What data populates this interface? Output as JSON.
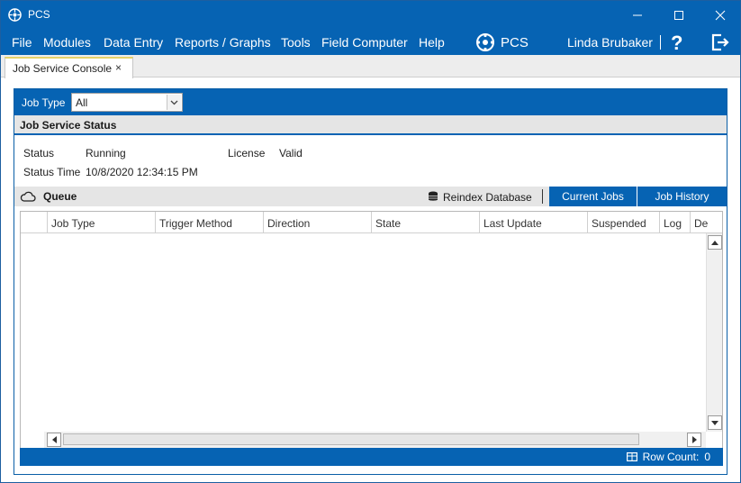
{
  "window": {
    "title": "PCS",
    "controls": {
      "minimize_icon": "minimize-icon",
      "maximize_icon": "maximize-icon",
      "close_icon": "close-icon"
    }
  },
  "menu": {
    "items": [
      "File",
      "Modules",
      "Data Entry",
      "Reports / Graphs",
      "Tools",
      "Field Computer",
      "Help"
    ],
    "brand": "PCS",
    "user": "Linda Brubaker",
    "help_label": "?"
  },
  "tabs": [
    {
      "label": "Job Service Console",
      "close": "×"
    }
  ],
  "filter": {
    "label": "Job Type",
    "value": "All"
  },
  "status": {
    "title": "Job Service Status",
    "status_label": "Status",
    "status_value": "Running",
    "license_label": "License",
    "license_value": "Valid",
    "time_label": "Status Time",
    "time_value": "10/8/2020 12:34:15 PM"
  },
  "queue": {
    "title": "Queue",
    "reindex_label": "Reindex Database",
    "current_jobs": "Current Jobs",
    "job_history": "Job History"
  },
  "grid": {
    "columns": [
      "",
      "Job Type",
      "Trigger Method",
      "Direction",
      "State",
      "Last Update",
      "Suspended",
      "Log",
      "De"
    ],
    "rows": []
  },
  "footer": {
    "row_count_label": "Row Count:",
    "row_count_value": "0"
  },
  "colors": {
    "accent": "#0663b3",
    "section_bg": "#e5e5e5",
    "tab_highlight": "#e6d36a"
  }
}
